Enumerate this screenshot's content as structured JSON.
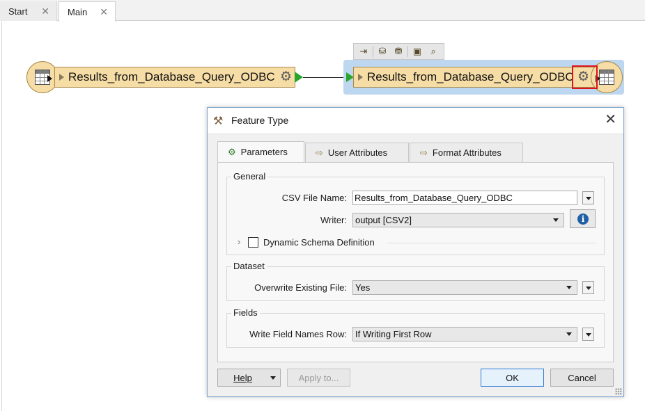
{
  "tabs": [
    {
      "label": "Start",
      "close": "✕"
    },
    {
      "label": "Main",
      "close": "✕"
    }
  ],
  "canvas": {
    "reader_node": {
      "name": "Results_from_Database_Query_ODBC"
    },
    "writer_node": {
      "name": "Results_from_Database_Query_ODBC"
    },
    "mini_toolbar_icons": [
      "insert-icon",
      "db-link-icon",
      "db-settings-icon",
      "folder-icon",
      "inspect-icon"
    ]
  },
  "dialog": {
    "title": "Feature Type",
    "close": "✕",
    "tabs": [
      {
        "label": "Parameters",
        "icon": "gear-icon"
      },
      {
        "label": "User Attributes",
        "icon": "arrow-icon"
      },
      {
        "label": "Format Attributes",
        "icon": "arrow-icon"
      }
    ],
    "general": {
      "title": "General",
      "csv_label": "CSV File Name:",
      "csv_value": "Results_from_Database_Query_ODBC",
      "writer_label": "Writer:",
      "writer_value": "output [CSV2]",
      "dynamic_label": "Dynamic Schema Definition"
    },
    "dataset": {
      "title": "Dataset",
      "overwrite_label": "Overwrite Existing File:",
      "overwrite_value": "Yes"
    },
    "fields": {
      "title": "Fields",
      "write_names_label": "Write Field Names Row:",
      "write_names_value": "If Writing First Row"
    },
    "buttons": {
      "help": "Help",
      "apply": "Apply to...",
      "ok": "OK",
      "cancel": "Cancel"
    }
  },
  "colors": {
    "node_fill": "#f6dca5",
    "selection": "#bcd7ef",
    "highlight": "#e0141e",
    "port_green": "#2aa52a"
  }
}
